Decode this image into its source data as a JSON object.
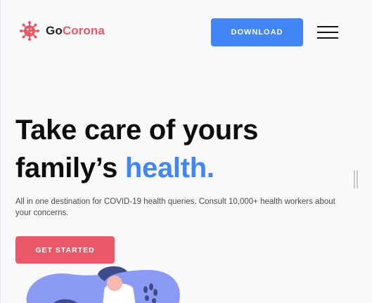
{
  "brand": {
    "name_part1": "Go",
    "name_part2": "Corona"
  },
  "header": {
    "download_label": "DOWNLOAD"
  },
  "hero": {
    "title_line1": "Take care of yours",
    "title_line2_prefix": "family’s ",
    "title_line2_accent": "health.",
    "description": "All in one destination for COVID-19 health queries. Consult 10,000+ health workers about your concerns.",
    "cta_label": "GET STARTED"
  },
  "colors": {
    "brand_red": "#e85766",
    "primary_blue": "#4285f4",
    "cta_red": "#e9596a",
    "blob_blue": "#8b9bf4"
  },
  "icons": {
    "logo": "virus-icon",
    "menu": "hamburger-menu-icon"
  }
}
